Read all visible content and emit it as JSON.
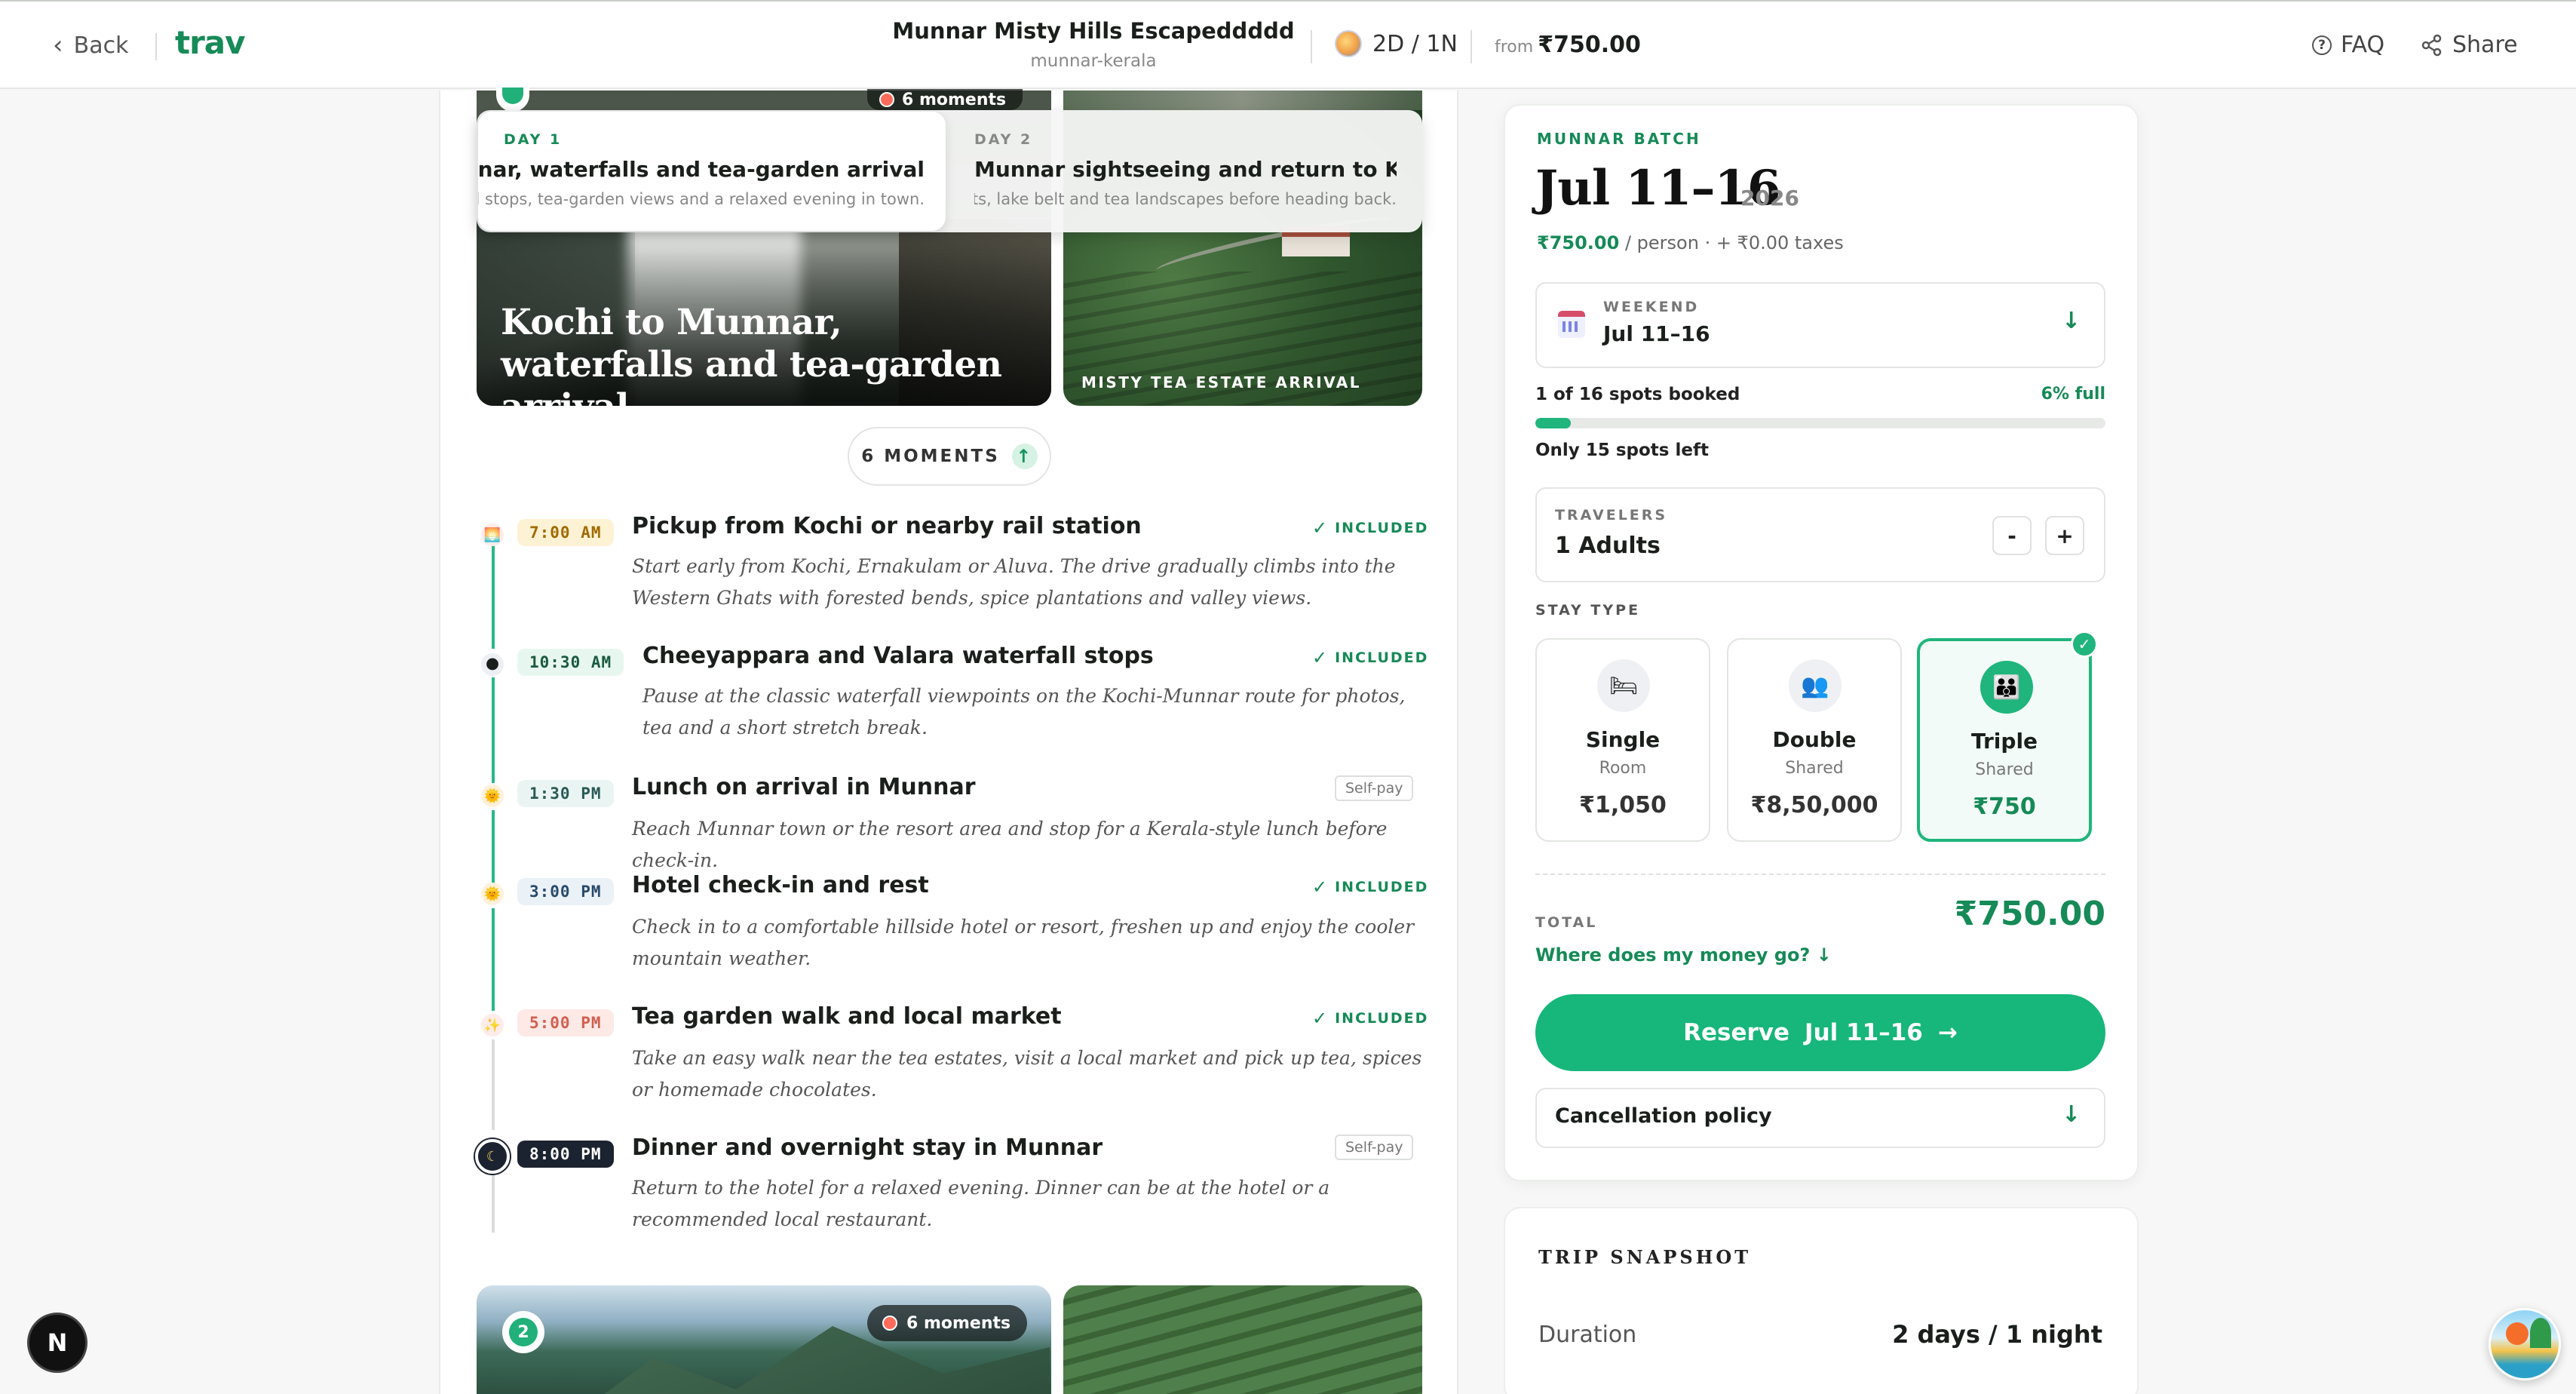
{
  "nav": {
    "back_label": "Back",
    "brand": "trav",
    "trip_title": "Munnar Misty Hills Escapeddddd",
    "trip_slug": "munnar-kerala",
    "duration": "2D / 1N",
    "from_label": "from",
    "from_price": "₹750.00",
    "faq_label": "FAQ",
    "share_label": "Share"
  },
  "hero": {
    "moments_badge": "6 moments",
    "title": "Kochi to Munnar, waterfalls and tea-garden arrival",
    "side_label": "MISTY TEA ESTATE ARRIVAL"
  },
  "day_tabs": [
    {
      "label": "DAY 1",
      "title": "Kochi to Munnar, waterfalls and tea-garden arrival",
      "sub": "A scenic uphill drive with waterfall stops, tea-garden views and a relaxed evening in town.",
      "active": true
    },
    {
      "label": "DAY 2",
      "title": "Munnar sightseeing and return to Kochi",
      "sub": "Explore Munnar's signature viewpoints, lake belt and tea landscapes before heading back.",
      "active": false
    }
  ],
  "moments_toggle": "6 MOMENTS",
  "timeline": [
    {
      "time": "7:00 AM",
      "title": "Pickup from Kochi or nearby rail station",
      "desc": "Start early from Kochi, Ernakulam or Aluva. The drive gradually climbs into the Western Ghats with forested bends, spice plantations and valley views.",
      "status": "INCLUDED",
      "icon": "sunrise-icon"
    },
    {
      "time": "10:30 AM",
      "title": "Cheeyappara and Valara waterfall stops",
      "desc": "Pause at the classic waterfall viewpoints on the Kochi-Munnar route for photos, tea and a short stretch break.",
      "status": "INCLUDED",
      "icon": "morning-icon"
    },
    {
      "time": "1:30 PM",
      "title": "Lunch on arrival in Munnar",
      "desc": "Reach Munnar town or the resort area and stop for a Kerala-style lunch before check-in.",
      "status": "Self-pay",
      "icon": "sun-icon"
    },
    {
      "time": "3:00 PM",
      "title": "Hotel check-in and rest",
      "desc": "Check in to a comfortable hillside hotel or resort, freshen up and enjoy the cooler mountain weather.",
      "status": "INCLUDED",
      "icon": "sun-icon"
    },
    {
      "time": "5:00 PM",
      "title": "Tea garden walk and local market",
      "desc": "Take an easy walk near the tea estates, visit a local market and pick up tea, spices or homemade chocolates.",
      "status": "INCLUDED",
      "icon": "sunset-icon"
    },
    {
      "time": "8:00 PM",
      "title": "Dinner and overnight stay in Munnar",
      "desc": "Return to the hotel for a relaxed evening. Dinner can be at the hotel or a recommended local restaurant.",
      "status": "Self-pay",
      "icon": "moon-icon"
    }
  ],
  "day2_preview": {
    "number": "2",
    "moments_badge": "6 moments"
  },
  "booking": {
    "batch_label": "MUNNAR BATCH",
    "batch_date": "Jul 11–16",
    "batch_year": "2026",
    "price": "₹750.00",
    "price_suffix": "/ person · + ₹0.00 taxes",
    "date_select_label": "WEEKEND",
    "date_select_value": "Jul 11–16",
    "spots_text": "1 of 16 spots booked",
    "spots_pct": "6% full",
    "spots_fill_fraction": 0.0625,
    "spots_left": "Only 15 spots left",
    "travelers_label": "TRAVELERS",
    "travelers_value": "1 Adults",
    "minus": "-",
    "plus": "+",
    "stay_type_label": "STAY TYPE",
    "stay_types": [
      {
        "name": "Single",
        "sub": "Room",
        "price": "₹1,050",
        "selected": false,
        "icon": "bed-icon"
      },
      {
        "name": "Double",
        "sub": "Shared",
        "price": "₹8,50,000",
        "selected": false,
        "icon": "two-people-icon"
      },
      {
        "name": "Triple",
        "sub": "Shared",
        "price": "₹750",
        "selected": true,
        "icon": "group-icon"
      }
    ],
    "total_label": "TOTAL",
    "total_value": "₹750.00",
    "money_link": "Where does my money go?",
    "reserve_label": "Reserve",
    "reserve_date": "Jul 11–16",
    "cancellation_label": "Cancellation policy"
  },
  "snapshot": {
    "title": "TRIP SNAPSHOT",
    "duration_key": "Duration",
    "duration_value": "2 days / 1 night"
  },
  "floating": {
    "dev_badge": "N"
  },
  "colors": {
    "accent": "#17b67a",
    "accent_dark": "#168a57",
    "text": "#1a1f1c"
  }
}
